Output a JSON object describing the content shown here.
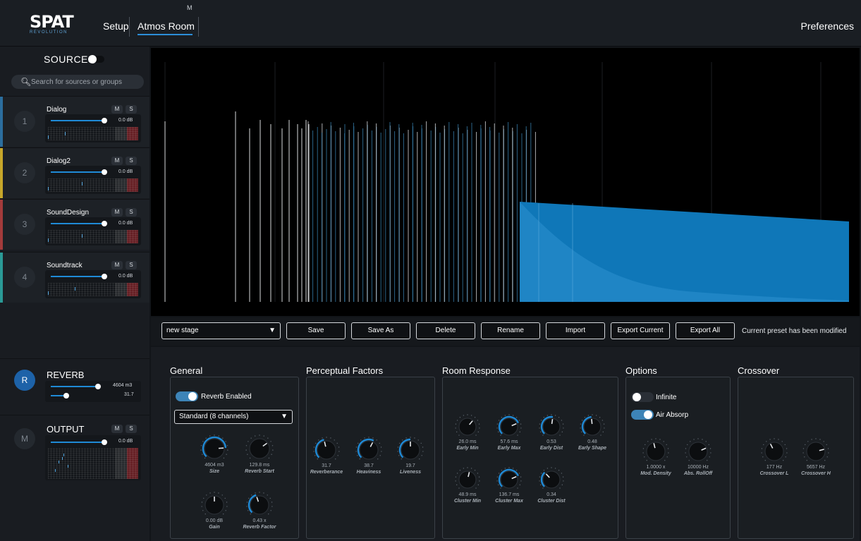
{
  "app": {
    "logo_text": "SPAT",
    "logo_sub": "REVOLUTION",
    "tabs": [
      {
        "label": "Setup"
      },
      {
        "label": "Atmos Room",
        "badge": "M",
        "active": true
      }
    ],
    "preferences_label": "Preferences"
  },
  "sources_panel": {
    "title": "SOURCES",
    "search_placeholder": "Search for sources or groups",
    "sources": [
      {
        "number": "1",
        "name": "Dialog",
        "level": "0.0 dB",
        "mute": "M",
        "solo": "S",
        "color": "#2b6e9e"
      },
      {
        "number": "2",
        "name": "Dialog2",
        "level": "0.0 dB",
        "mute": "M",
        "solo": "S",
        "color": "#c7a62a"
      },
      {
        "number": "3",
        "name": "SoundDesign",
        "level": "0.0 dB",
        "mute": "M",
        "solo": "S",
        "color": "#a33b3b"
      },
      {
        "number": "4",
        "name": "Soundtrack",
        "level": "0.0 dB",
        "mute": "M",
        "solo": "S",
        "color": "#2a9a96"
      }
    ],
    "reverb": {
      "letter": "R",
      "title": "REVERB",
      "size_value": "4604 m3",
      "second_value": "31.7"
    },
    "output": {
      "letter": "M",
      "title": "OUTPUT",
      "level": "0.0 dB",
      "mute": "M",
      "solo": "S"
    }
  },
  "preset_bar": {
    "selected_preset": "new stage",
    "buttons": [
      "Save",
      "Save As",
      "Delete",
      "Rename",
      "Import",
      "Export Current",
      "Export All"
    ],
    "status": "Current preset has been modified"
  },
  "general": {
    "title": "General",
    "reverb_enabled_label": "Reverb Enabled",
    "reverb_enabled": true,
    "channel_format": "Standard (8 channels)",
    "knobs": [
      {
        "value": "4604 m3",
        "label": "Size"
      },
      {
        "value": "129.8 ms",
        "label": "Reverb Start"
      },
      {
        "value": "0.00 dB",
        "label": "Gain"
      },
      {
        "value": "0.43 x",
        "label": "Reverb Factor"
      }
    ]
  },
  "perceptual": {
    "title": "Perceptual Factors",
    "knobs": [
      {
        "value": "31.7",
        "label": "Reverberance"
      },
      {
        "value": "38.7",
        "label": "Heaviness"
      },
      {
        "value": "19.7",
        "label": "Liveness"
      }
    ]
  },
  "room_response": {
    "title": "Room Response",
    "knobs": [
      {
        "value": "26.0 ms",
        "label": "Early Min"
      },
      {
        "value": "57.6 ms",
        "label": "Early Max"
      },
      {
        "value": "0.53",
        "label": "Early Dist"
      },
      {
        "value": "0.48",
        "label": "Early Shape"
      },
      {
        "value": "48.9 ms",
        "label": "Cluster Min"
      },
      {
        "value": "136.7 ms",
        "label": "Cluster Max"
      },
      {
        "value": "0.34",
        "label": "Cluster Dist"
      }
    ]
  },
  "options": {
    "title": "Options",
    "infinite_label": "Infinite",
    "infinite": false,
    "air_absorp_label": "Air Absorp",
    "air_absorp": true,
    "knobs": [
      {
        "value": "1.0000 x",
        "label": "Mod. Density"
      },
      {
        "value": "10000 Hz",
        "label": "Abs. RollOff"
      }
    ]
  },
  "crossover": {
    "title": "Crossover",
    "knobs": [
      {
        "value": "177 Hz",
        "label": "Crossover L"
      },
      {
        "value": "5657 Hz",
        "label": "Crossover H"
      }
    ]
  },
  "colors": {
    "accent": "#1f8ad6",
    "reverb_fill": "#0f77b8",
    "background": "#121519"
  }
}
